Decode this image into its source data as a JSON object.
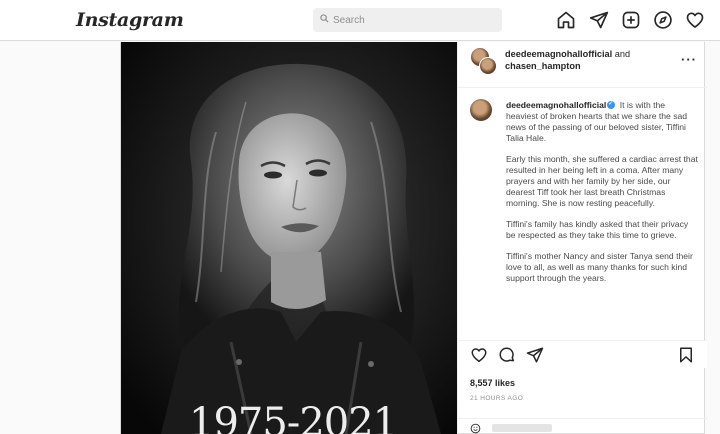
{
  "nav": {
    "logo": "Instagram",
    "search_placeholder": "Search",
    "icons": [
      "home-icon",
      "direct-icon",
      "new-post-icon",
      "explore-icon",
      "activity-icon"
    ]
  },
  "post": {
    "header": {
      "author": "deedeemagnohallofficial",
      "and_text": " and",
      "coauthor": "chasen_hampton",
      "more_label": "···"
    },
    "photo": {
      "overlay_text": "1975-2021"
    },
    "caption": {
      "username": "deedeemagnohallofficial",
      "paragraphs": [
        "It is with the heaviest of broken hearts that we share the sad news of the passing of our beloved sister, Tiffini Talia Hale.",
        "Early this month, she suffered a cardiac arrest that resulted in her being left in a coma. After many prayers and with her family by her side, our dearest Tiff took her last breath Christmas morning. She is now resting peacefully.",
        "Tiffini's family has kindly asked that their privacy be respected as they take this time to grieve.",
        "Tiffini's mother Nancy and sister Tanya send their love to all, as well as many thanks for such kind support through the years."
      ]
    },
    "likes": "8,557 likes",
    "timestamp": "21 HOURS AGO",
    "colors": {
      "verified": "#3897f0",
      "border": "#dbdbdb",
      "muted": "#8e8e8e"
    }
  }
}
